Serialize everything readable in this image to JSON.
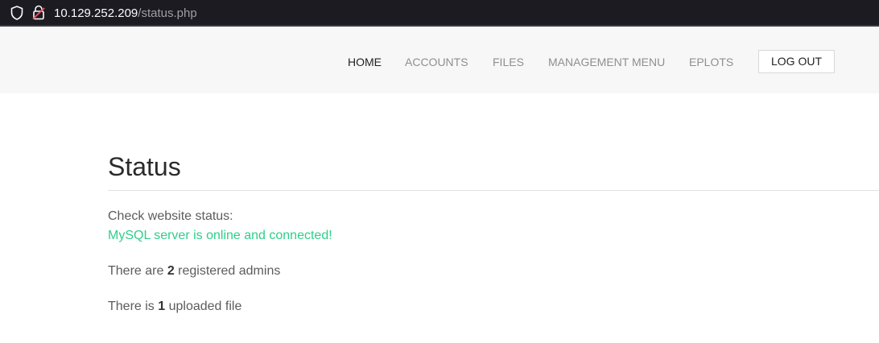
{
  "browser": {
    "url_host": "10.129.252.209",
    "url_path": "/status.php"
  },
  "nav": {
    "items": [
      {
        "label": "HOME",
        "active": true
      },
      {
        "label": "ACCOUNTS",
        "active": false
      },
      {
        "label": "FILES",
        "active": false
      },
      {
        "label": "MANAGEMENT MENU",
        "active": false
      },
      {
        "label": "EPLOTS",
        "active": false
      }
    ],
    "logout_label": "LOG OUT"
  },
  "main": {
    "title": "Status",
    "check_label": "Check website status:",
    "mysql_status": "MySQL server is online and connected!",
    "admins": {
      "prefix": "There are ",
      "count": "2",
      "suffix": " registered admins"
    },
    "files": {
      "prefix": "There is ",
      "count": "1",
      "suffix": " uploaded file"
    }
  },
  "colors": {
    "success": "#2fce8b",
    "navbar_bg": "#f7f7f7",
    "urlbar_bg": "#1c1b22"
  }
}
